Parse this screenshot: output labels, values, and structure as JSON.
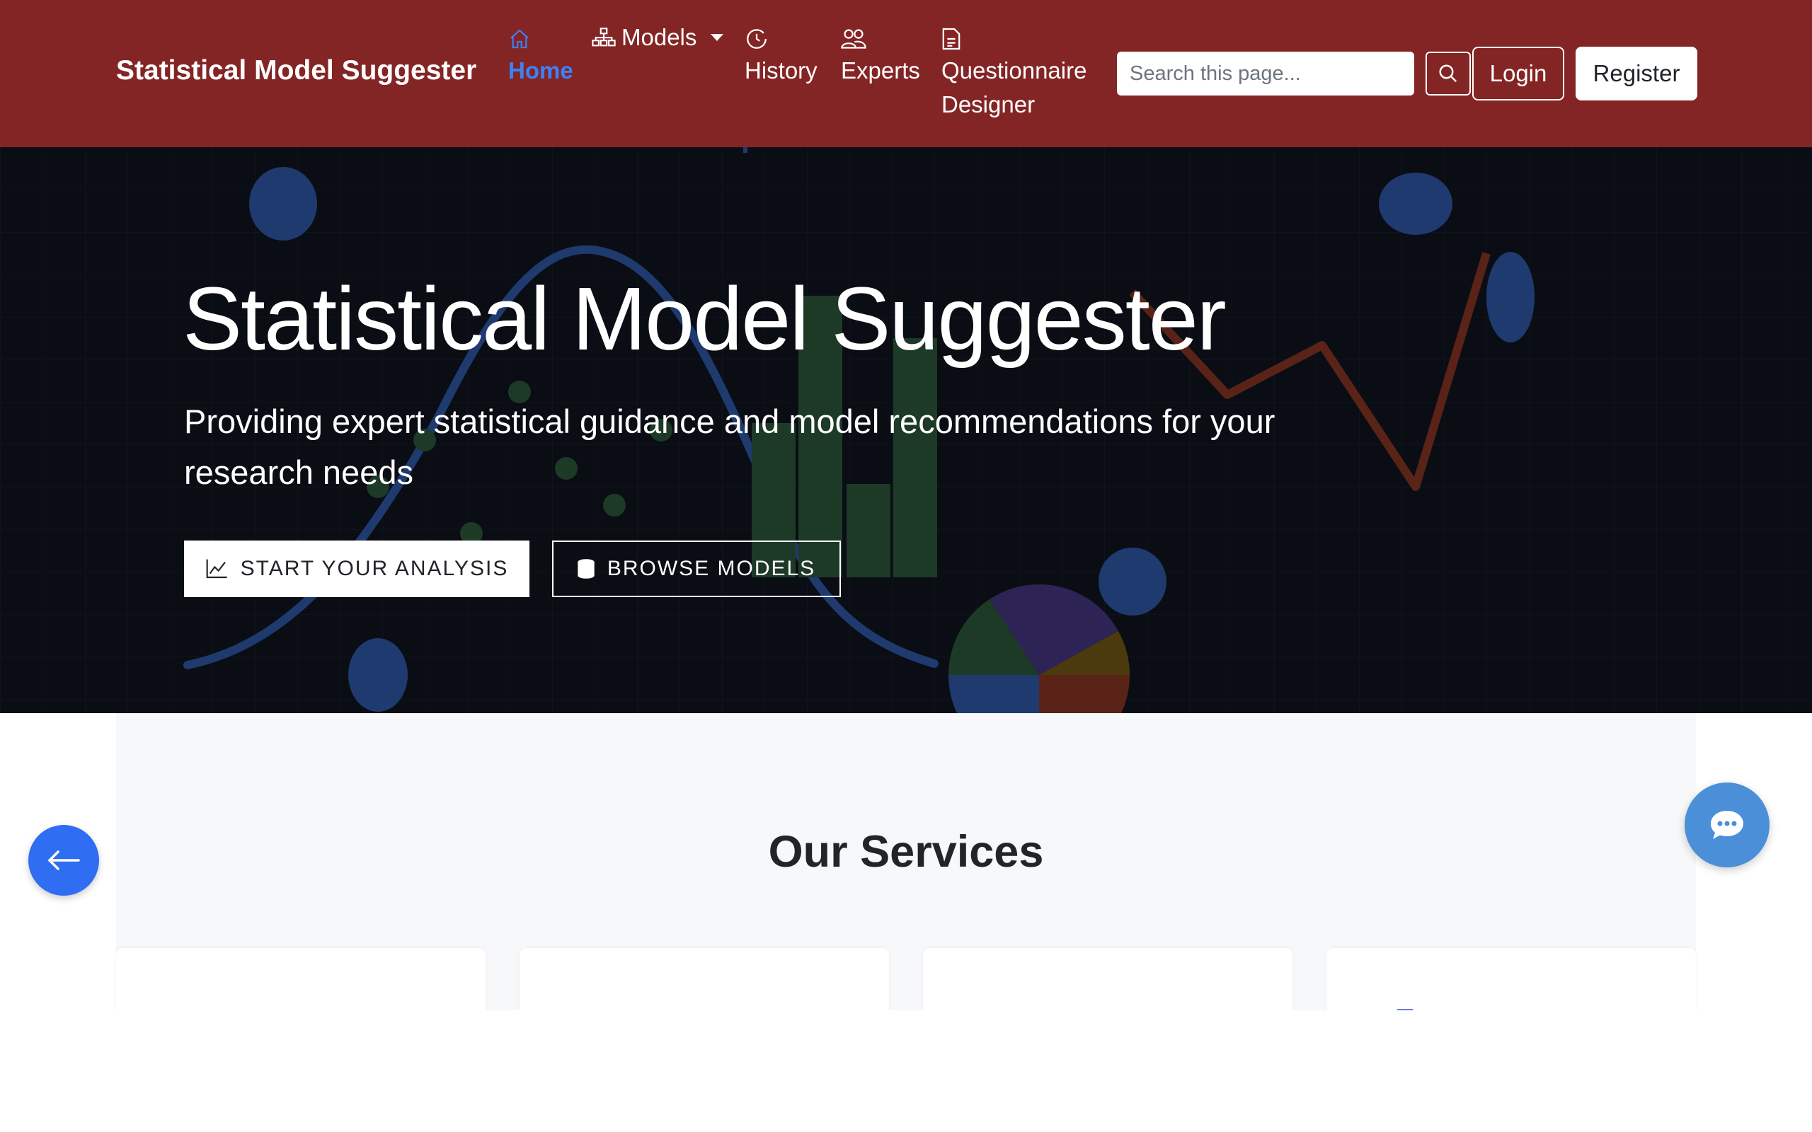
{
  "navbar": {
    "brand": "Statistical Model Suggester",
    "items": [
      {
        "label": "Home",
        "icon": "home-icon"
      },
      {
        "label": "Models",
        "icon": "sitemap-icon"
      },
      {
        "label": "History",
        "icon": "clock-icon"
      },
      {
        "label": "Experts",
        "icon": "people-icon"
      },
      {
        "label": "Questionnaire",
        "label2": "Designer",
        "icon": "document-icon"
      }
    ],
    "search_placeholder": "Search this page...",
    "login_label": "Login",
    "register_label": "Register",
    "colors": {
      "background": "#842525",
      "active": "#3b82f6"
    }
  },
  "hero": {
    "title": "Statistical Model Suggester",
    "subtitle": "Providing expert statistical guidance and model recommendations for your research needs",
    "primary_button": "START YOUR ANALYSIS",
    "secondary_button": "BROWSE MODELS",
    "background": "#0a0d14"
  },
  "services": {
    "title": "Our Services"
  },
  "floating": {
    "back_icon": "arrow-left-icon",
    "chat_icon": "chat-bubble-icon"
  }
}
